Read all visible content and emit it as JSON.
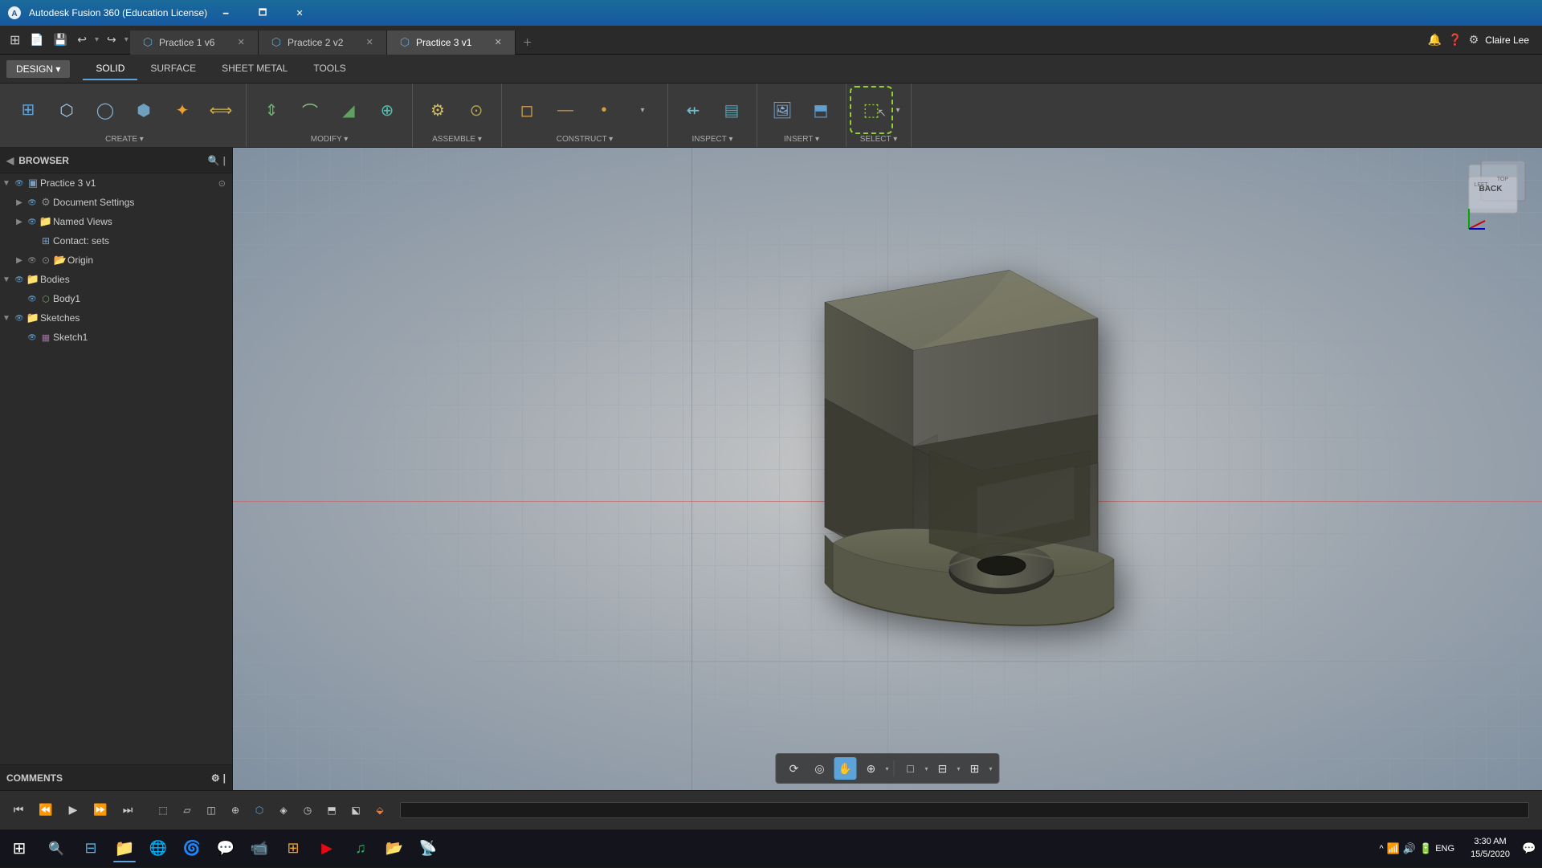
{
  "titlebar": {
    "app_name": "Autodesk Fusion 360 (Education License)",
    "minimize": "🗕",
    "restore": "🗖",
    "close": "✕"
  },
  "tabs": [
    {
      "id": "tab1",
      "label": "Practice 1 v6",
      "active": false
    },
    {
      "id": "tab2",
      "label": "Practice 2 v2",
      "active": false
    },
    {
      "id": "tab3",
      "label": "Practice 3 v1",
      "active": true
    }
  ],
  "design": {
    "label": "DESIGN ▾"
  },
  "toolbar_tabs": [
    "SOLID",
    "SURFACE",
    "SHEET METAL",
    "TOOLS"
  ],
  "toolbar_tab_active": "SOLID",
  "ribbon": {
    "groups": [
      {
        "label": "CREATE",
        "has_caret": true,
        "buttons": [
          "create-extrude",
          "create-revolve",
          "create-sweep",
          "create-loft",
          "create-mirror",
          "create-pattern"
        ]
      },
      {
        "label": "MODIFY",
        "has_caret": true,
        "buttons": [
          "modify-press-pull",
          "modify-fillet",
          "modify-chamfer",
          "modify-shell"
        ]
      },
      {
        "label": "ASSEMBLE",
        "has_caret": true,
        "buttons": [
          "assemble-joint",
          "assemble-rigid"
        ]
      },
      {
        "label": "CONSTRUCT",
        "has_caret": true,
        "buttons": [
          "construct-plane",
          "construct-axis",
          "construct-point"
        ]
      },
      {
        "label": "INSPECT",
        "has_caret": true,
        "buttons": [
          "inspect-measure",
          "inspect-interference"
        ]
      },
      {
        "label": "INSERT",
        "has_caret": true,
        "buttons": [
          "insert-canvas",
          "insert-decal"
        ]
      },
      {
        "label": "SELECT",
        "has_caret": true,
        "buttons": [
          "select-box"
        ]
      }
    ]
  },
  "browser": {
    "title": "BROWSER"
  },
  "tree": {
    "root": "Practice 3 v1",
    "items": [
      {
        "id": "doc-settings",
        "label": "Document Settings",
        "level": 1,
        "expanded": false,
        "icon": "gear"
      },
      {
        "id": "named-views",
        "label": "Named Views",
        "level": 1,
        "expanded": false,
        "icon": "folder"
      },
      {
        "id": "contact-sets",
        "label": "Contact: sets",
        "level": 1,
        "expanded": false,
        "icon": "contact"
      },
      {
        "id": "origin",
        "label": "Origin",
        "level": 1,
        "expanded": false,
        "icon": "origin"
      },
      {
        "id": "bodies",
        "label": "Bodies",
        "level": 1,
        "expanded": true,
        "icon": "folder"
      },
      {
        "id": "body1",
        "label": "Body1",
        "level": 2,
        "expanded": false,
        "icon": "body"
      },
      {
        "id": "sketches",
        "label": "Sketches",
        "level": 1,
        "expanded": true,
        "icon": "folder"
      },
      {
        "id": "sketch1",
        "label": "Sketch1",
        "level": 2,
        "expanded": false,
        "icon": "sketch"
      }
    ]
  },
  "comments": {
    "label": "COMMENTS"
  },
  "viewport_toolbar": {
    "buttons": [
      "orbit",
      "look-at",
      "pan",
      "zoom",
      "view-options",
      "display-mode",
      "grid"
    ]
  },
  "anim_controls": {
    "first": "⏮",
    "prev": "⏪",
    "play": "▶",
    "next": "⏩",
    "last": "⏭"
  },
  "nav_cube": {
    "face": "BACK"
  },
  "taskbar": {
    "time": "3:30 AM",
    "date": "15/5/2020",
    "language": "ENG",
    "items": [
      "windows-start",
      "search",
      "task-view",
      "file-explorer",
      "edge",
      "chrome",
      "discord",
      "zoom",
      "explorer",
      "netflix",
      "spotify",
      "folder2",
      "streamlabs"
    ]
  },
  "user": {
    "name": "Claire Lee"
  }
}
